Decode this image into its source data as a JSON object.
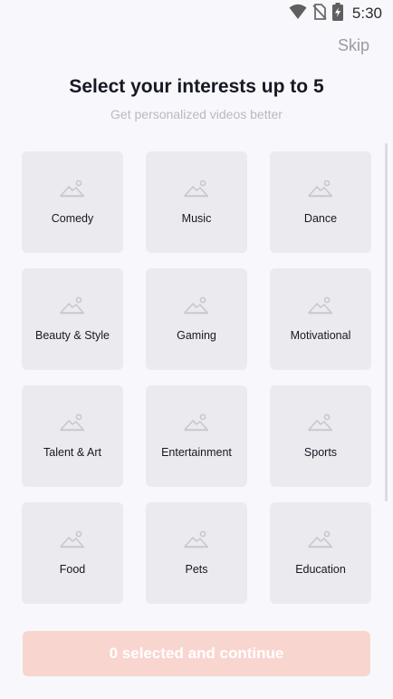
{
  "status_bar": {
    "time": "5:30",
    "icons": [
      "wifi-icon",
      "no-sim-icon",
      "battery-charging-icon"
    ]
  },
  "header": {
    "skip_label": "Skip"
  },
  "main": {
    "title": "Select your interests up to 5",
    "subtitle": "Get personalized videos better",
    "interests": [
      {
        "label": "Comedy",
        "icon": "image-placeholder-icon"
      },
      {
        "label": "Music",
        "icon": "image-placeholder-icon"
      },
      {
        "label": "Dance",
        "icon": "image-placeholder-icon"
      },
      {
        "label": "Beauty & Style",
        "icon": "image-placeholder-icon"
      },
      {
        "label": "Gaming",
        "icon": "image-placeholder-icon"
      },
      {
        "label": "Motivational",
        "icon": "image-placeholder-icon"
      },
      {
        "label": "Talent & Art",
        "icon": "image-placeholder-icon"
      },
      {
        "label": "Entertainment",
        "icon": "image-placeholder-icon"
      },
      {
        "label": "Sports",
        "icon": "image-placeholder-icon"
      },
      {
        "label": "Food",
        "icon": "image-placeholder-icon"
      },
      {
        "label": "Pets",
        "icon": "image-placeholder-icon"
      },
      {
        "label": "Education",
        "icon": "image-placeholder-icon"
      }
    ]
  },
  "footer": {
    "continue_label": "0 selected and continue"
  },
  "colors": {
    "background": "#f8f7fc",
    "card": "#ebeaef",
    "button_disabled": "#f9d5cf",
    "subtitle": "#b9b9be"
  }
}
